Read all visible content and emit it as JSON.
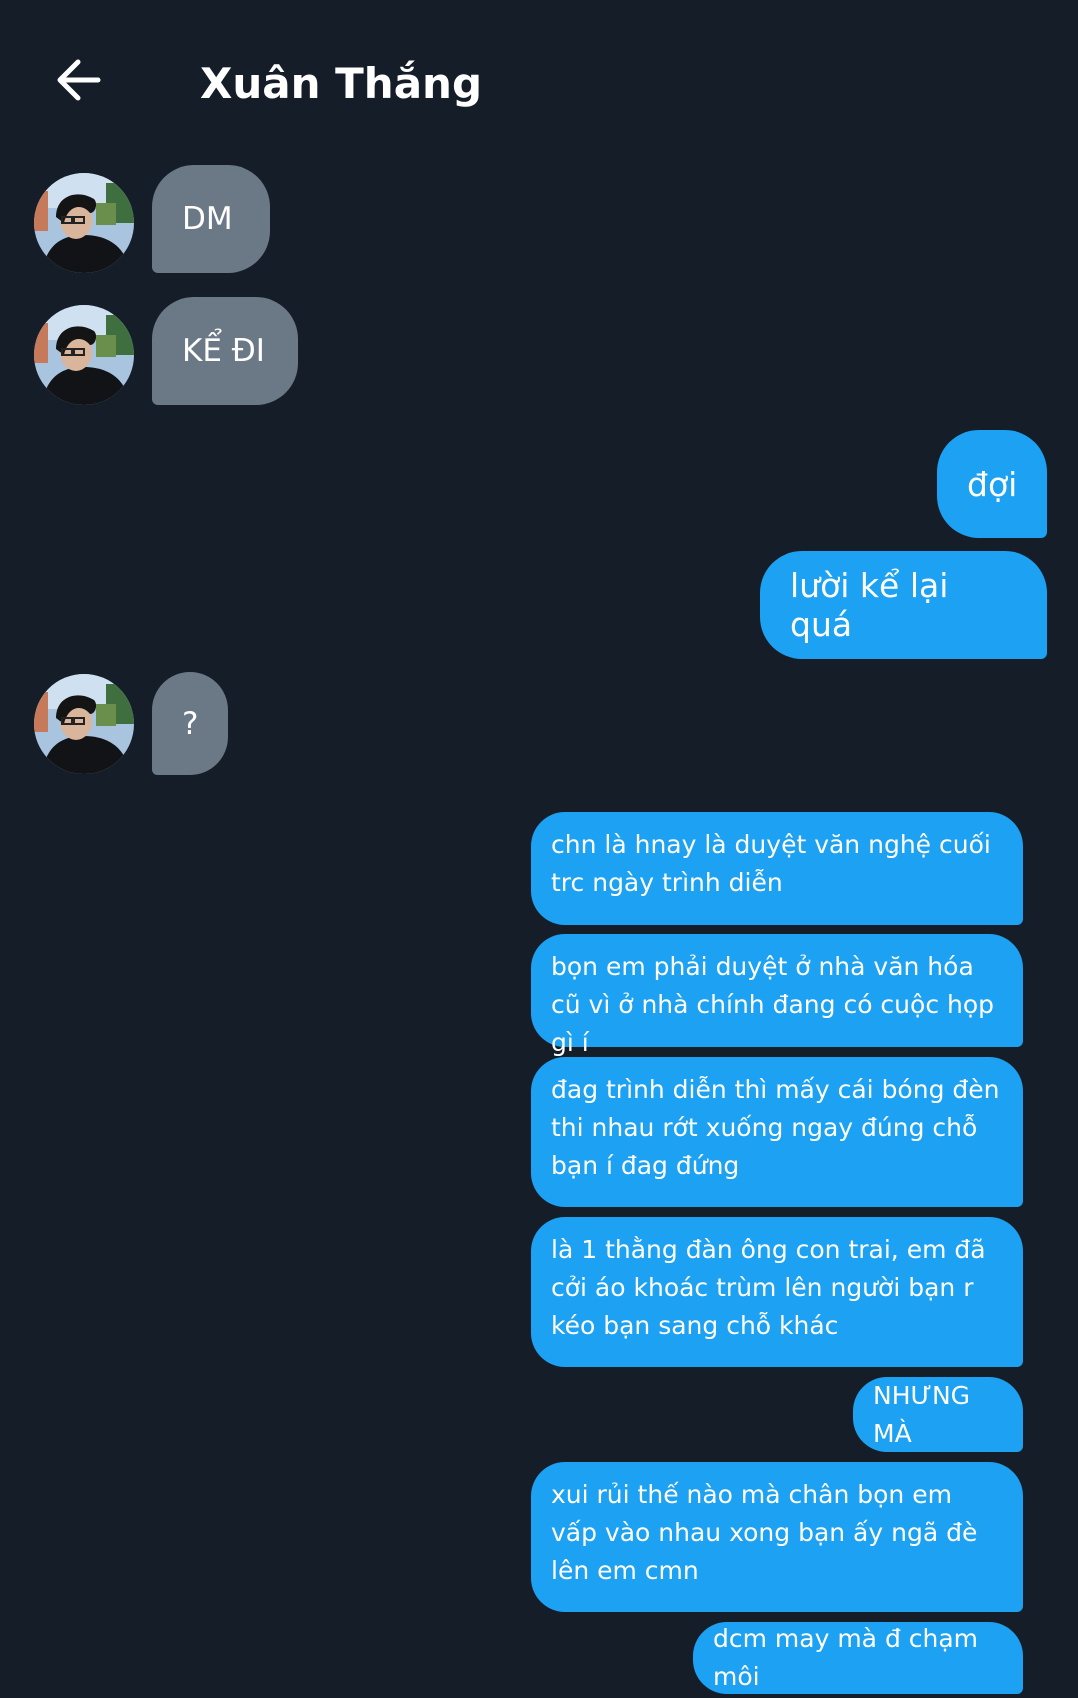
{
  "header": {
    "back_icon": "arrow-left-icon",
    "title": "Xuân Thắng"
  },
  "colors": {
    "background": "#151e28",
    "received_bubble": "#6b7886",
    "sent_bubble": "#1da1f2"
  },
  "messages": {
    "m1": "DM",
    "m2": "KỂ ĐI",
    "m3": "đợi",
    "m4": "lười kể lại quá",
    "m5": "?",
    "m6": "chn là hnay là duyệt văn nghệ cuối trc ngày trình diễn",
    "m7": "bọn em phải duyệt ở nhà văn hóa cũ vì ở nhà chính đang có cuộc họp gì í",
    "m8": "đag trình diễn thì mấy cái bóng đèn thi nhau rớt xuống ngay đúng chỗ bạn í đag đứng",
    "m9": "là 1 thằng đàn ông con trai, em đã cởi áo khoác trùm lên người bạn r kéo bạn sang chỗ khác",
    "m10": "NHƯNG MÀ",
    "m11": "xui rủi thế nào mà chân bọn em vấp vào nhau xong bạn ấy ngã đè lên em cmn",
    "m12": "dcm may mà đ chạm môi"
  }
}
